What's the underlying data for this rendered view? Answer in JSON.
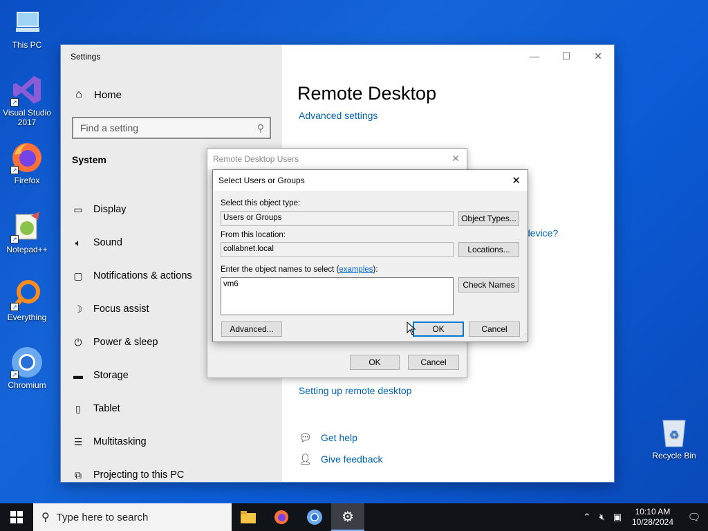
{
  "desktop": {
    "icons": [
      {
        "label": "This PC",
        "icon": "computer-icon"
      },
      {
        "label": "Visual Studio 2017",
        "icon": "visual-studio-icon"
      },
      {
        "label": "Firefox",
        "icon": "firefox-icon"
      },
      {
        "label": "Notepad++",
        "icon": "notepad-plus-plus-icon"
      },
      {
        "label": "Everything",
        "icon": "everything-search-icon"
      },
      {
        "label": "Chromium",
        "icon": "chromium-icon"
      },
      {
        "label": "Recycle Bin",
        "icon": "recycle-bin-icon"
      }
    ]
  },
  "settings": {
    "app_title": "Settings",
    "home": "Home",
    "search_placeholder": "Find a setting",
    "section": "System",
    "nav": [
      {
        "label": "Display",
        "icon": "monitor-icon"
      },
      {
        "label": "Sound",
        "icon": "speaker-icon"
      },
      {
        "label": "Notifications & actions",
        "icon": "notification-icon"
      },
      {
        "label": "Focus assist",
        "icon": "moon-icon"
      },
      {
        "label": "Power & sleep",
        "icon": "power-icon"
      },
      {
        "label": "Storage",
        "icon": "storage-icon"
      },
      {
        "label": "Tablet",
        "icon": "tablet-icon"
      },
      {
        "label": "Multitasking",
        "icon": "multitasking-icon"
      },
      {
        "label": "Projecting to this PC",
        "icon": "projecting-icon"
      }
    ],
    "page_title": "Remote Desktop",
    "advanced_settings": "Advanced settings",
    "partial_colon": ":",
    "partial_device": "device?",
    "setup_link": "Setting up remote desktop",
    "get_help": "Get help",
    "give_feedback": "Give feedback"
  },
  "rdu_dialog": {
    "title": "Remote Desktop Users",
    "ok": "OK",
    "cancel": "Cancel"
  },
  "select_dialog": {
    "title": "Select Users or Groups",
    "object_type_label": "Select this object type:",
    "object_type_value": "Users or Groups",
    "object_types_button": "Object Types...",
    "location_label": "From this location:",
    "location_value": "collabnet.local",
    "locations_button": "Locations...",
    "names_label_prefix": "Enter the object names to select (",
    "names_label_link": "examples",
    "names_label_suffix": "):",
    "names_value": "vm6",
    "check_names_button": "Check Names",
    "advanced_button": "Advanced...",
    "ok": "OK",
    "cancel": "Cancel"
  },
  "taskbar": {
    "search_placeholder": "Type here to search",
    "time": "10:10 AM",
    "date": "10/28/2024"
  },
  "colors": {
    "accent": "#0078d7",
    "link": "#0063b1",
    "desktop": "#0a5ad0"
  }
}
